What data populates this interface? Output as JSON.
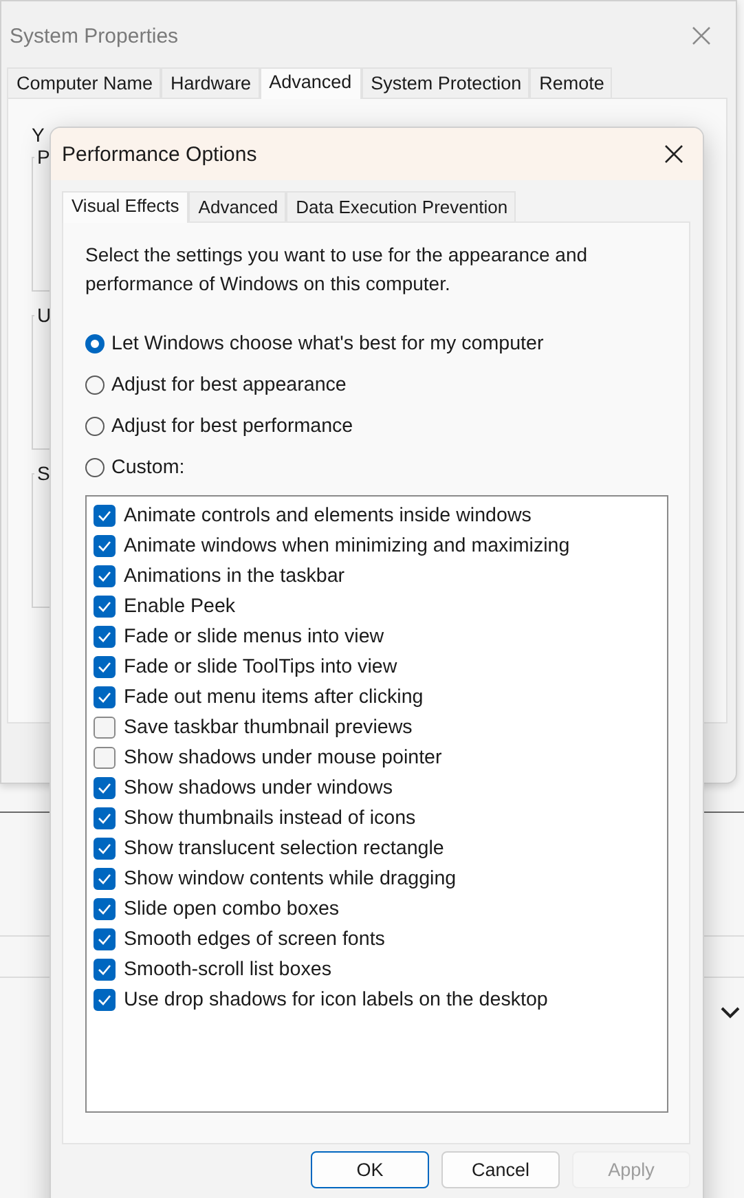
{
  "background_window": {
    "title": "System Properties",
    "tabs": [
      {
        "label": "Computer Name",
        "selected": false
      },
      {
        "label": "Hardware",
        "selected": false
      },
      {
        "label": "Advanced",
        "selected": true
      },
      {
        "label": "System Protection",
        "selected": false
      },
      {
        "label": "Remote",
        "selected": false
      }
    ],
    "intro": "Y",
    "groups": [
      "P",
      "U",
      "S"
    ]
  },
  "dialog": {
    "title": "Performance Options",
    "tabs": [
      {
        "label": "Visual Effects",
        "selected": true
      },
      {
        "label": "Advanced",
        "selected": false
      },
      {
        "label": "Data Execution Prevention",
        "selected": false
      }
    ],
    "description": "Select the settings you want to use for the appearance and performance of Windows on this computer.",
    "options": [
      {
        "label": "Let Windows choose what's best for my computer",
        "selected": true
      },
      {
        "label": "Adjust for best appearance",
        "selected": false
      },
      {
        "label": "Adjust for best performance",
        "selected": false
      },
      {
        "label": "Custom:",
        "selected": false
      }
    ],
    "effects": [
      {
        "label": "Animate controls and elements inside windows",
        "checked": true
      },
      {
        "label": "Animate windows when minimizing and maximizing",
        "checked": true
      },
      {
        "label": "Animations in the taskbar",
        "checked": true
      },
      {
        "label": "Enable Peek",
        "checked": true
      },
      {
        "label": "Fade or slide menus into view",
        "checked": true
      },
      {
        "label": "Fade or slide ToolTips into view",
        "checked": true
      },
      {
        "label": "Fade out menu items after clicking",
        "checked": true
      },
      {
        "label": "Save taskbar thumbnail previews",
        "checked": false
      },
      {
        "label": "Show shadows under mouse pointer",
        "checked": false
      },
      {
        "label": "Show shadows under windows",
        "checked": true
      },
      {
        "label": "Show thumbnails instead of icons",
        "checked": true
      },
      {
        "label": "Show translucent selection rectangle",
        "checked": true
      },
      {
        "label": "Show window contents while dragging",
        "checked": true
      },
      {
        "label": "Slide open combo boxes",
        "checked": true
      },
      {
        "label": "Smooth edges of screen fonts",
        "checked": true
      },
      {
        "label": "Smooth-scroll list boxes",
        "checked": true
      },
      {
        "label": "Use drop shadows for icon labels on the desktop",
        "checked": true
      }
    ],
    "buttons": [
      {
        "label": "OK",
        "default": true,
        "disabled": false
      },
      {
        "label": "Cancel",
        "default": false,
        "disabled": false
      },
      {
        "label": "Apply",
        "default": false,
        "disabled": true
      }
    ]
  }
}
